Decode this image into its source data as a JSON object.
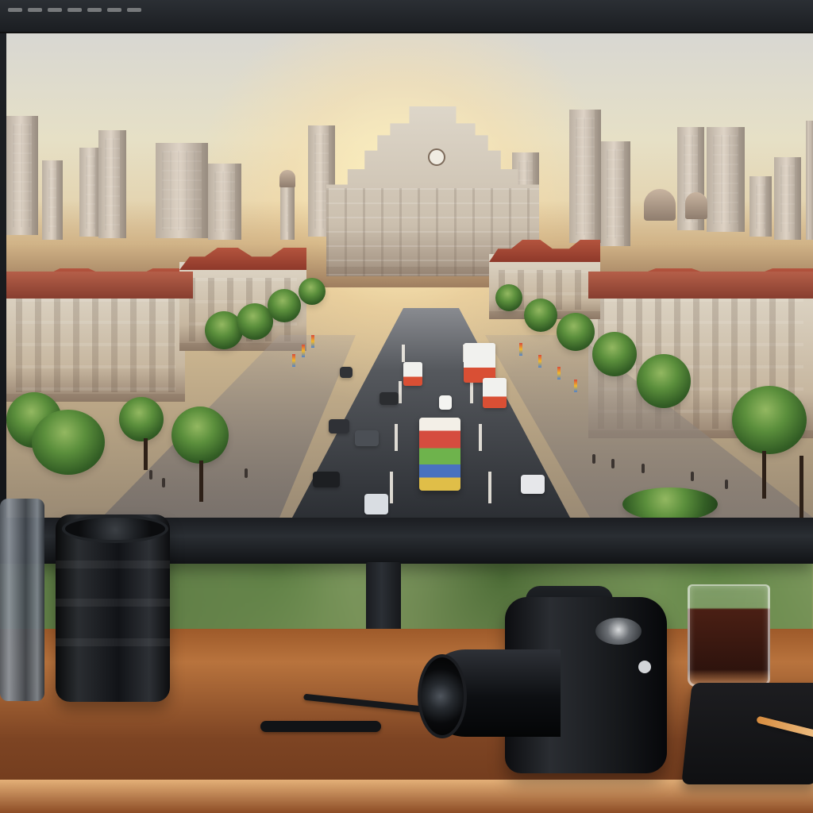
{
  "scene": {
    "type": "desk-photo",
    "screen_content": "city-view",
    "accent_colors": {
      "wood": "#9b5b2c",
      "sunset": "#f1d59c",
      "roof_red": "#a54a36",
      "foliage": "#4f7d34",
      "monitor": "#16181b"
    },
    "icons": [
      "camera-icon",
      "lens-icon",
      "glass-icon",
      "notebook-icon",
      "pen-icon"
    ]
  }
}
